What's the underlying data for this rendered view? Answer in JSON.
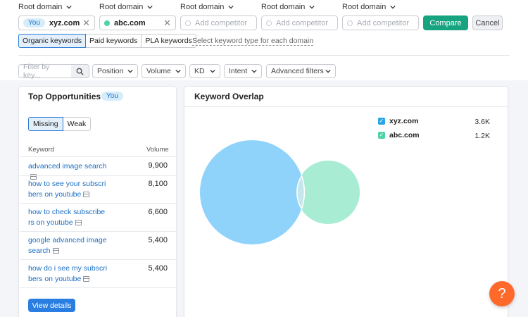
{
  "domains": {
    "label": "Root domain",
    "you_badge": "You",
    "first": "xyz.com",
    "second": "abc.com",
    "placeholder": "Add competitor"
  },
  "actions": {
    "compare": "Compare",
    "cancel": "Cancel"
  },
  "keyword_types": {
    "tabs": [
      "Organic keywords",
      "Paid keywords",
      "PLA keywords"
    ],
    "hint": "Select keyword type for each domain"
  },
  "filters": {
    "search_placeholder": "Filter by key...",
    "dropdowns": [
      "Position",
      "Volume",
      "KD",
      "Intent",
      "Advanced filters"
    ]
  },
  "top_opportunities": {
    "title": "Top Opportunities",
    "badge": "You",
    "tabs": [
      "Missing",
      "Weak"
    ],
    "col_keyword": "Keyword",
    "col_volume": "Volume",
    "rows": [
      {
        "line1": "advanced image search",
        "line2": "",
        "volume": "9,900"
      },
      {
        "line1": "how to see your subscri",
        "line2": "bers on youtube",
        "volume": "8,100"
      },
      {
        "line1": "how to check subscribe",
        "line2": "rs on youtube",
        "volume": "6,600"
      },
      {
        "line1": "google advanced image",
        "line2": " search",
        "volume": "5,400"
      },
      {
        "line1": "how do i see my subscri",
        "line2": "bers on youtube",
        "volume": "5,400"
      }
    ],
    "view_details": "View details"
  },
  "keyword_overlap": {
    "title": "Keyword Overlap",
    "legend": [
      {
        "name": "xyz.com",
        "value": "3.6K",
        "color": "#2aa5e6"
      },
      {
        "name": "abc.com",
        "value": "1.2K",
        "color": "#4ed3a6"
      }
    ],
    "circle_colors": {
      "first": "#8fd3fb",
      "second": "#a8ecd3"
    }
  },
  "help": {
    "label": "?"
  }
}
